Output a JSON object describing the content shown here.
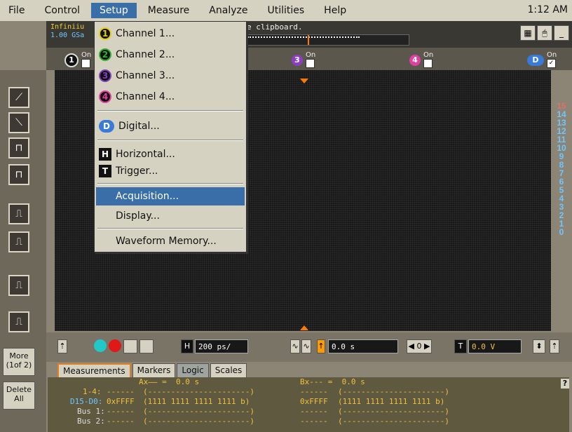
{
  "menubar": {
    "items": [
      "File",
      "Control",
      "Setup",
      "Measure",
      "Analyze",
      "Utilities",
      "Help"
    ],
    "active": "Setup",
    "clock": "1:12 AM"
  },
  "status": {
    "line1": "Infiniiu",
    "line2": "1.00 GSa",
    "clipboard_text": "e clipboard."
  },
  "channels": [
    {
      "num": "1",
      "label": "On",
      "color": "#e8e8e8",
      "checked": false
    },
    {
      "num": "3",
      "label": "On",
      "color": "#8a40c0",
      "checked": false
    },
    {
      "num": "4",
      "label": "On",
      "color": "#e040a0",
      "checked": false
    },
    {
      "num": "D",
      "label": "On",
      "color": "#3a7ad8",
      "checked": true
    }
  ],
  "setup_menu": {
    "items": [
      {
        "label": "Channel 1...",
        "icon": "channel-1-icon",
        "color": "#e8d000"
      },
      {
        "label": "Channel 2...",
        "icon": "channel-2-icon",
        "color": "#30b030"
      },
      {
        "label": "Channel 3...",
        "icon": "channel-3-icon",
        "color": "#8040c0"
      },
      {
        "label": "Channel 4...",
        "icon": "channel-4-icon",
        "color": "#e040a0"
      },
      {
        "label": "Digital...",
        "icon": "digital-icon",
        "color": "#3a7ad8"
      },
      {
        "label": "Horizontal...",
        "icon": "horizontal-icon"
      },
      {
        "label": "Trigger...",
        "icon": "trigger-icon"
      },
      {
        "label": "Acquisition...",
        "selected": true
      },
      {
        "label": "Display..."
      },
      {
        "label": "Waveform Memory..."
      }
    ]
  },
  "side_buttons": {
    "more": "More",
    "more_sub": "(1of 2)",
    "delete": "Delete",
    "delete_sub": "All"
  },
  "digital_numbers": [
    "15",
    "14",
    "13",
    "12",
    "11",
    "10",
    "9",
    "8",
    "7",
    "6",
    "5",
    "4",
    "3",
    "2",
    "1",
    "0"
  ],
  "controls": {
    "horizontal_label": "H",
    "timebase": "200 ps/",
    "delay": "0.0 s",
    "trigger_label": "T",
    "trigger_level": "0.0 V"
  },
  "tabs": [
    "Measurements",
    "Markers",
    "Logic",
    "Scales"
  ],
  "logic": {
    "ax": "Ax—— =  0.0 s",
    "bx": "Bx--- =  0.0 s",
    "row1_label": "1-4:",
    "row1_a": "------",
    "row1_b": "(----------------------)",
    "row1_c": "------",
    "row1_d": "(----------------------)",
    "row2_label": "D15-D0:",
    "row2_a": "0xFFFF",
    "row2_b": "(1111 1111 1111 1111 b)",
    "row2_c": "0xFFFF",
    "row2_d": "(1111 1111 1111 1111 b)",
    "row3_label": "Bus 1:",
    "row3_a": "------",
    "row3_b": "(----------------------)",
    "row3_c": "------",
    "row3_d": "(----------------------)",
    "row4_label": "Bus 2:",
    "row4_a": "------",
    "row4_b": "(----------------------)",
    "row4_c": "------",
    "row4_d": "(----------------------)"
  },
  "help_q": "?"
}
